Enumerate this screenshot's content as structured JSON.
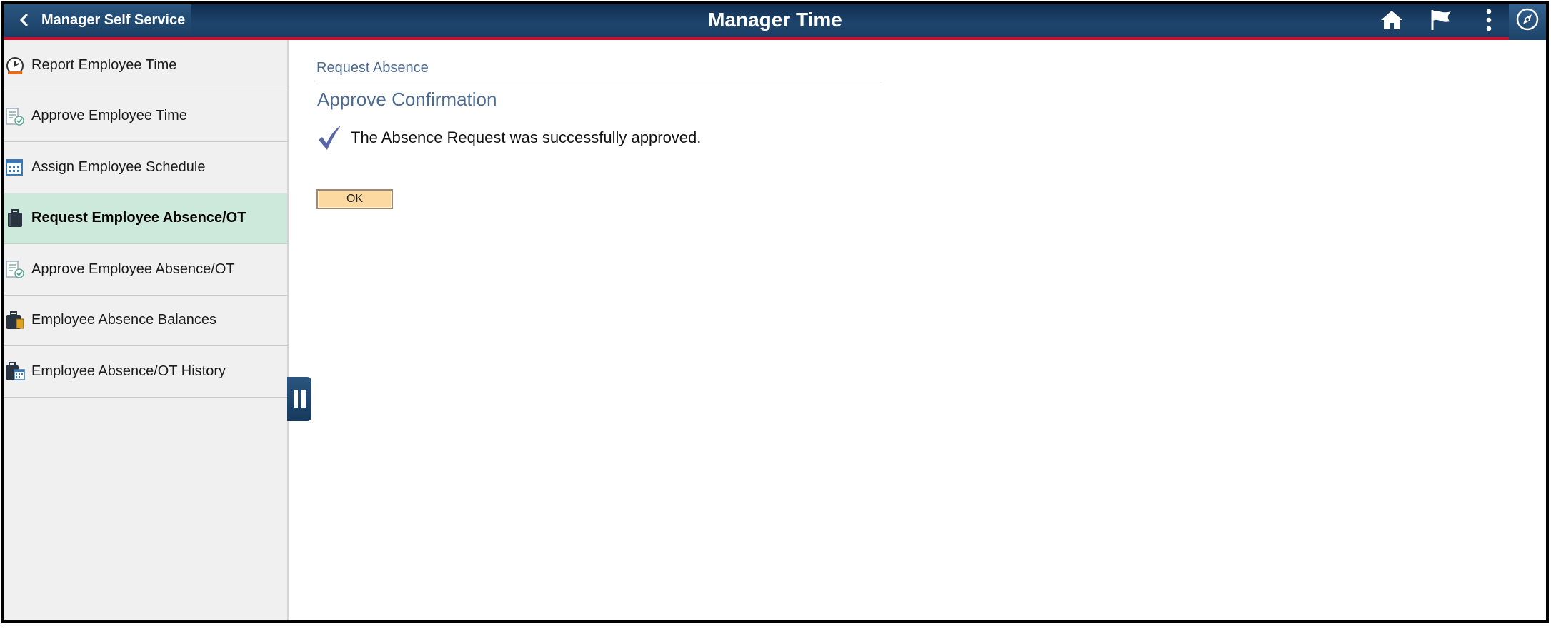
{
  "header": {
    "back_label": "Manager Self Service",
    "title": "Manager Time",
    "icons": [
      "home-icon",
      "flag-icon",
      "more-vertical-icon",
      "compass-icon"
    ],
    "accent_color": "#c8102e"
  },
  "sidebar": {
    "items": [
      {
        "label": "Report Employee Time",
        "icon": "clock-icon",
        "active": false
      },
      {
        "label": "Approve Employee Time",
        "icon": "approve-list-icon",
        "active": false
      },
      {
        "label": "Assign Employee Schedule",
        "icon": "calendar-icon",
        "active": false
      },
      {
        "label": "Request Employee Absence/OT",
        "icon": "suitcase-icon",
        "active": true
      },
      {
        "label": "Approve Employee Absence/OT",
        "icon": "approve-list-icon",
        "active": false
      },
      {
        "label": "Employee Absence Balances",
        "icon": "balance-suitcase-icon",
        "active": false
      },
      {
        "label": "Employee Absence/OT History",
        "icon": "history-calendar-icon",
        "active": false
      }
    ],
    "active_color": "#cde9dc"
  },
  "main": {
    "breadcrumb": "Request Absence",
    "section_title": "Approve Confirmation",
    "message": "The Absence Request was successfully approved.",
    "ok_label": "OK"
  }
}
